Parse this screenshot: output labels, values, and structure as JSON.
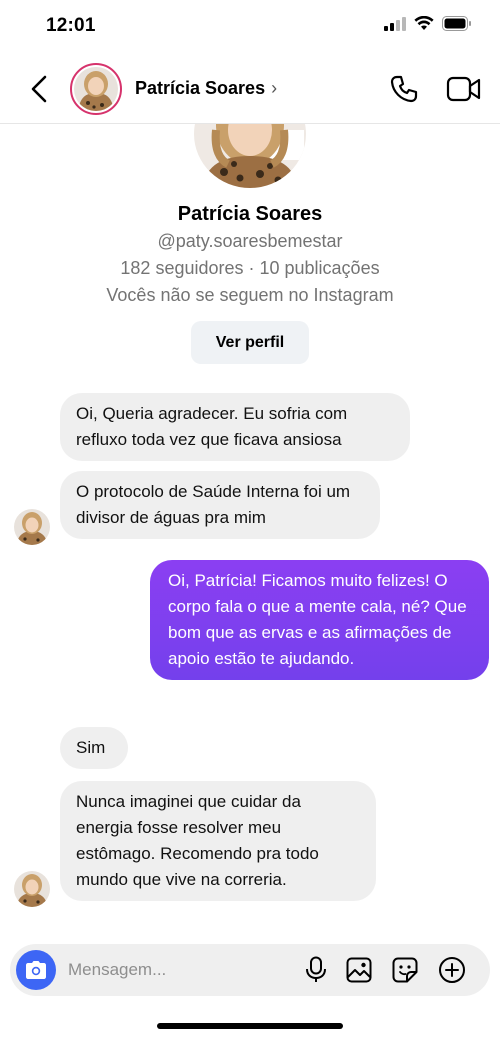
{
  "status_bar": {
    "time": "12:01"
  },
  "header": {
    "contact_name": "Patrícia Soares",
    "chevron": "›",
    "icons": [
      "back-arrow-icon",
      "phone-icon",
      "video-icon"
    ]
  },
  "profile": {
    "name": "Patrícia Soares",
    "handle": "@paty.soaresbemestar",
    "stats": "182 seguidores · 10 publicações",
    "follow_status": "Vocês não se seguem no Instagram",
    "view_profile_label": "Ver perfil"
  },
  "messages": [
    {
      "from": "them",
      "text": "Oi, Queria agradecer. Eu sofria com refluxo toda vez que ficava ansiosa"
    },
    {
      "from": "them",
      "text": "O protocolo de Saúde Interna foi um divisor de águas pra mim"
    },
    {
      "from": "me",
      "text": "Oi, Patrícia! Ficamos muito felizes! O corpo fala o que a mente cala, né? Que bom que as ervas e as afirmações de apoio estão te ajudando."
    },
    {
      "from": "them",
      "text": "Sim"
    },
    {
      "from": "them",
      "text": "Nunca imaginei que cuidar da energia fosse resolver meu estômago. Recomendo pra todo mundo que vive na correria."
    }
  ],
  "composer": {
    "placeholder": "Mensagem...",
    "icons": [
      "camera-icon",
      "microphone-icon",
      "gallery-icon",
      "sticker-icon",
      "plus-circle-icon"
    ]
  },
  "colors": {
    "outgoing_bubble": "#7a3df0",
    "incoming_bubble": "#efefef",
    "camera_button": "#3d66f5",
    "avatar_ring": "#d6336c"
  }
}
